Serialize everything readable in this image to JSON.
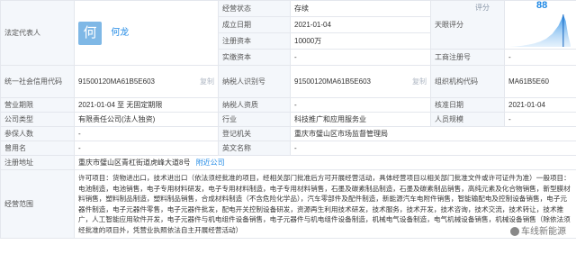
{
  "rep": {
    "label": "法定代表人",
    "avatar_char": "何",
    "name": "何龙"
  },
  "status": {
    "label": "经营状态",
    "value": "存续"
  },
  "founded": {
    "label": "成立日期",
    "value": "2021-01-04"
  },
  "score": {
    "label": "天眼评分",
    "chart_label": "评分",
    "value": "88"
  },
  "reg_capital": {
    "label": "注册资本",
    "value": "10000万"
  },
  "paid_capital": {
    "label": "实缴资本",
    "value": "-"
  },
  "biz_reg_no": {
    "label": "工商注册号",
    "value": "-"
  },
  "credit_code": {
    "label": "统一社会信用代码",
    "value": "91500120MA61B5E603"
  },
  "taxpayer_id": {
    "label": "纳税人识别号",
    "value": "91500120MA61B5E603"
  },
  "org_code": {
    "label": "组织机构代码",
    "value": "MA61B5E60"
  },
  "term": {
    "label": "营业期限",
    "value": "2021-01-04 至 无固定期限"
  },
  "tax_qual": {
    "label": "纳税人资质",
    "value": "-"
  },
  "approve_date": {
    "label": "核准日期",
    "value": "2021-01-04"
  },
  "company_type": {
    "label": "公司类型",
    "value": "有限责任公司(法人独资)"
  },
  "industry": {
    "label": "行业",
    "value": "科技推广和应用服务业"
  },
  "staff": {
    "label": "人员规模",
    "value": "-"
  },
  "insured": {
    "label": "参保人数",
    "value": "-"
  },
  "reg_authority": {
    "label": "登记机关",
    "value": "重庆市璧山区市场监督管理局"
  },
  "former_name": {
    "label": "曾用名",
    "value": "-"
  },
  "english_name": {
    "label": "英文名称",
    "value": "-"
  },
  "address": {
    "label": "注册地址",
    "value": "重庆市璧山区青杠街道虎峰大道8号",
    "link": "附近公司"
  },
  "scope": {
    "label": "经营范围",
    "value": "许可项目：货物进出口，技术进出口（依法须经批准的项目，经相关部门批准后方可开展经营活动，具体经营项目以相关部门批准文件或许可证件为准）一般项目：电池制造，电池销售，电子专用材料研发，电子专用材料制造，电子专用材料销售，石墨及碳素制品制造，石墨及碳素制品销售，高纯元素及化合物销售，新型膜材料销售，塑料制品制造，塑料制品销售，合成材料制造（不含危险化学品），汽车零部件及配件制造，新能源汽车电附件销售，智能输配电及控制设备销售，电子元器件制造，电子元器件零售，电子元器件批发，配电开关控制设备研发，资源再生利用技术研发，技术服务，技术开发，技术咨询，技术交流，技术转让，技术推广，人工智能应用软件开发，电子元器件与机电组件设备销售，电子元器件与机电组件设备制造，机械电气设备制造，电气机械设备销售，机械设备销售（除依法须经批准的项目外，凭营业执照依法自主开展经营活动）"
  },
  "copy_label": "复制",
  "watermark": "车线新能源",
  "colors": {
    "accent": "#1e88e5",
    "label_bg": "#f4f7fb",
    "border": "#e4e7ed"
  },
  "chart_data": {
    "type": "area",
    "title": "评分",
    "value": 88,
    "x": [
      0,
      10,
      20,
      30,
      40,
      50,
      60,
      70,
      80,
      85,
      88,
      92,
      96,
      100
    ],
    "y": [
      0,
      0.01,
      0.03,
      0.06,
      0.1,
      0.16,
      0.25,
      0.4,
      0.65,
      0.85,
      1.0,
      0.8,
      0.35,
      0.05
    ]
  }
}
